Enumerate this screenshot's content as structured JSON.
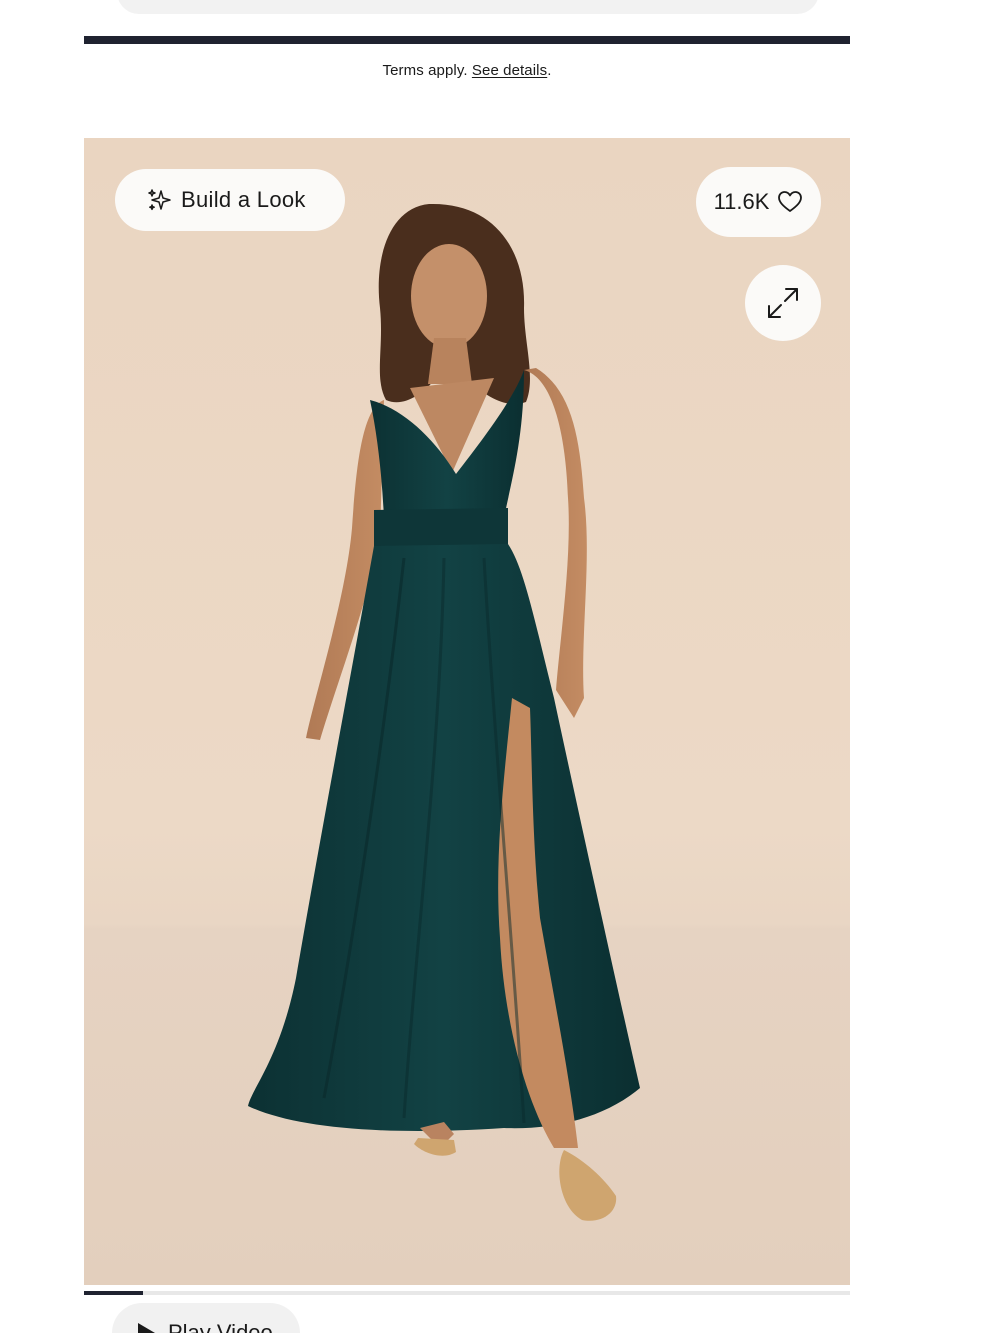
{
  "terms": {
    "prefix": "Terms apply.",
    "link": "See details",
    "suffix": "."
  },
  "gallery": {
    "build_look_label": "Build a Look",
    "build_look_icon": "sparkle-icon",
    "likes_count": "11.6K",
    "likes_icon": "heart-icon",
    "expand_icon": "expand-arrows-icon",
    "image_progress": 0.077,
    "play_video_label": "Play Video",
    "play_icon": "play-icon"
  },
  "colors": {
    "accent_dark": "#1f2230",
    "dress": "#0f3a3c",
    "background": "#ebd6c3"
  }
}
